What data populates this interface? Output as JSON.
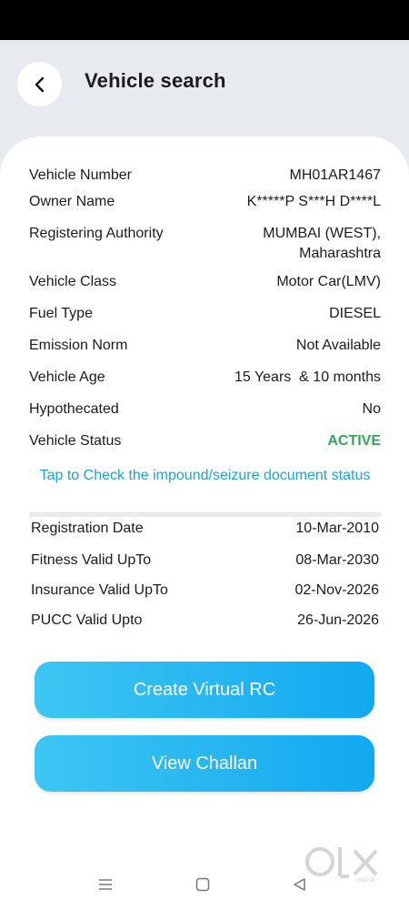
{
  "header": {
    "title": "Vehicle search"
  },
  "details": [
    {
      "label": "Vehicle Number",
      "value": "MH01AR1467"
    },
    {
      "label": "Owner Name",
      "value": "K*****P S***H D****L"
    },
    {
      "label": "Registering Authority",
      "value": "MUMBAI (WEST), Maharashtra"
    },
    {
      "label": "Vehicle Class",
      "value": "Motor Car(LMV)"
    },
    {
      "label": "Fuel Type",
      "value": "DIESEL"
    },
    {
      "label": "Emission Norm",
      "value": "Not Available"
    },
    {
      "label": "Vehicle Age",
      "value": "15 Years  & 10 months"
    },
    {
      "label": "Hypothecated",
      "value": "No"
    },
    {
      "label": "Vehicle Status",
      "value": "ACTIVE"
    }
  ],
  "impound_link": "Tap to Check the impound/seizure document status",
  "validity": [
    {
      "label": "Registration Date",
      "value": "10-Mar-2010"
    },
    {
      "label": "Fitness Valid UpTo",
      "value": "08-Mar-2030"
    },
    {
      "label": "Insurance Valid UpTo",
      "value": "02-Nov-2026"
    },
    {
      "label": "PUCC Valid Upto",
      "value": "26-Jun-2026"
    }
  ],
  "buttons": {
    "virtual_rc": "Create Virtual RC",
    "challan": "View Challan"
  },
  "watermark": {
    "brand": "OLX",
    "sub": "INDIA"
  },
  "colors": {
    "accent": "#12a8f0",
    "status_active": "#2fa84f",
    "link": "#1aa3d6"
  }
}
